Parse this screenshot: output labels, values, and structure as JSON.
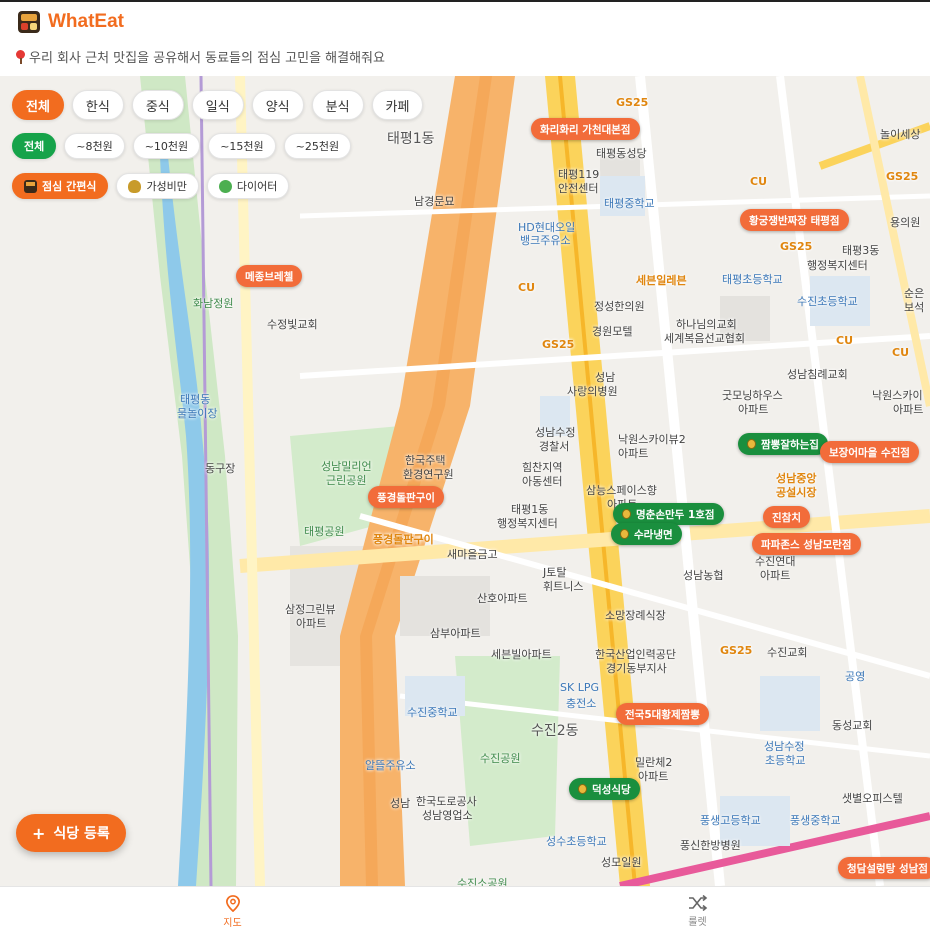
{
  "app": {
    "name": "WhatEat",
    "tagline": "우리 회사 근처 맛집을 공유해서 동료들의 점심 고민을 해결해줘요"
  },
  "filters": {
    "cuisine": [
      "전체",
      "한식",
      "중식",
      "일식",
      "양식",
      "분식",
      "카페"
    ],
    "price": [
      "전체",
      "~8천원",
      "~10천원",
      "~15천원",
      "~25천원"
    ],
    "tags": [
      "점심 간편식",
      "가성비만",
      "다이어터"
    ]
  },
  "map_labels": [
    {
      "id": "taepyeong1",
      "text": "태평1동",
      "cls": "big"
    },
    {
      "id": "taepyeong-sd",
      "text": "태평동성당",
      "cls": ""
    },
    {
      "id": "taepyeong119",
      "text": "태평119",
      "cls": ""
    },
    {
      "id": "safety",
      "text": "안전센터",
      "cls": ""
    },
    {
      "id": "taepyeong-ms",
      "text": "태평중학교",
      "cls": "blue"
    },
    {
      "id": "hd1",
      "text": "HD현대오일",
      "cls": "blue"
    },
    {
      "id": "hd2",
      "text": "뱅크주유소",
      "cls": "blue"
    },
    {
      "id": "namgyeong",
      "text": "남경문묘",
      "cls": ""
    },
    {
      "id": "sejong",
      "text": "세븐일레븐",
      "cls": "brand"
    },
    {
      "id": "cu1",
      "text": "CU",
      "cls": "brand"
    },
    {
      "id": "cu2",
      "text": "CU",
      "cls": "brand"
    },
    {
      "id": "cu3",
      "text": "CU",
      "cls": "brand"
    },
    {
      "id": "cu4",
      "text": "CU",
      "cls": "brand"
    },
    {
      "id": "gs1",
      "text": "GS25",
      "cls": "brand"
    },
    {
      "id": "gs2",
      "text": "GS25",
      "cls": "brand"
    },
    {
      "id": "gs3",
      "text": "GS25",
      "cls": "brand"
    },
    {
      "id": "gs4",
      "text": "GS25",
      "cls": "brand"
    },
    {
      "id": "gs5",
      "text": "GS25",
      "cls": "brand"
    },
    {
      "id": "jeongseong",
      "text": "정성한의원",
      "cls": ""
    },
    {
      "id": "gyeongwon",
      "text": "경원모텔",
      "cls": ""
    },
    {
      "id": "hananim1",
      "text": "하나님의교회",
      "cls": ""
    },
    {
      "id": "hananim2",
      "text": "세계복음선교협회",
      "cls": ""
    },
    {
      "id": "taepyeong-es",
      "text": "태평초등학교",
      "cls": "blue"
    },
    {
      "id": "sujin-es",
      "text": "수진초등학교",
      "cls": "blue"
    },
    {
      "id": "taepyeong3",
      "text": "태평3동",
      "cls": ""
    },
    {
      "id": "welfare3",
      "text": "행정복지센터",
      "cls": ""
    },
    {
      "id": "yongui",
      "text": "용의원",
      "cls": ""
    },
    {
      "id": "noise",
      "text": "놀이세상",
      "cls": ""
    },
    {
      "id": "sunlight",
      "text": "순은",
      "cls": ""
    },
    {
      "id": "boss",
      "text": "보석",
      "cls": ""
    },
    {
      "id": "hwanam",
      "text": "화남정원",
      "cls": "green"
    },
    {
      "id": "sujeongbit",
      "text": "수정빛교회",
      "cls": ""
    },
    {
      "id": "seongnam-hosp1",
      "text": "성남",
      "cls": ""
    },
    {
      "id": "seongnam-hosp2",
      "text": "사랑의병원",
      "cls": ""
    },
    {
      "id": "seongnamchim",
      "text": "성남침례교회",
      "cls": ""
    },
    {
      "id": "goodmorning1",
      "text": "굿모닝하우스",
      "cls": ""
    },
    {
      "id": "goodmorning2",
      "text": "아파트",
      "cls": ""
    },
    {
      "id": "naksky1",
      "text": "낙원스카이",
      "cls": ""
    },
    {
      "id": "naksky2",
      "text": "아파트",
      "cls": ""
    },
    {
      "id": "police1",
      "text": "성남수정",
      "cls": ""
    },
    {
      "id": "police2",
      "text": "경찰서",
      "cls": ""
    },
    {
      "id": "naksky3",
      "text": "낙원스카이뷰2",
      "cls": ""
    },
    {
      "id": "naksky4",
      "text": "아파트",
      "cls": ""
    },
    {
      "id": "seongnamjungang1",
      "text": "성남중앙",
      "cls": "brand"
    },
    {
      "id": "seongnamjungang2",
      "text": "공설시장",
      "cls": "brand"
    },
    {
      "id": "taepyeong-stream1",
      "text": "태평동",
      "cls": "blue"
    },
    {
      "id": "taepyeong-stream2",
      "text": "물놀이장",
      "cls": "blue"
    },
    {
      "id": "millipark1",
      "text": "성남밀리언",
      "cls": "green"
    },
    {
      "id": "millipark2",
      "text": "근린공원",
      "cls": "green"
    },
    {
      "id": "housing1",
      "text": "한국주택",
      "cls": ""
    },
    {
      "id": "housing2",
      "text": "환경연구원",
      "cls": ""
    },
    {
      "id": "childcare1",
      "text": "힘찬지역",
      "cls": ""
    },
    {
      "id": "childcare2",
      "text": "아동센터",
      "cls": ""
    },
    {
      "id": "dongu",
      "text": "동구장",
      "cls": ""
    },
    {
      "id": "samneung1",
      "text": "삼능스페이스향",
      "cls": ""
    },
    {
      "id": "samneung2",
      "text": "아파트",
      "cls": ""
    },
    {
      "id": "welfare1a",
      "text": "태평1동",
      "cls": ""
    },
    {
      "id": "welfare1b",
      "text": "행정복지센터",
      "cls": ""
    },
    {
      "id": "taepyeongpark",
      "text": "태평공원",
      "cls": "green"
    },
    {
      "id": "pungkyeong",
      "text": "풍경돌판구이",
      "cls": "brand"
    },
    {
      "id": "saemaeul",
      "text": "새마을금고",
      "cls": ""
    },
    {
      "id": "jtotal1",
      "text": "J토탈",
      "cls": ""
    },
    {
      "id": "jtotal2",
      "text": "휘트니스",
      "cls": ""
    },
    {
      "id": "sudeop",
      "text": "수진연대",
      "cls": ""
    },
    {
      "id": "sudeop2",
      "text": "아파트",
      "cls": ""
    },
    {
      "id": "nonghyup",
      "text": "성남농협",
      "cls": ""
    },
    {
      "id": "samjeong1",
      "text": "삼정그린뷰",
      "cls": ""
    },
    {
      "id": "samjeong2",
      "text": "아파트",
      "cls": ""
    },
    {
      "id": "sanho",
      "text": "산호아파트",
      "cls": ""
    },
    {
      "id": "sambu",
      "text": "삼부아파트",
      "cls": ""
    },
    {
      "id": "sobang",
      "text": "소망장례식장",
      "cls": ""
    },
    {
      "id": "serbil",
      "text": "세븐빌아파트",
      "cls": ""
    },
    {
      "id": "hrd1",
      "text": "한국산업인력공단",
      "cls": ""
    },
    {
      "id": "hrd2",
      "text": "경기동부지사",
      "cls": ""
    },
    {
      "id": "sujinchurch",
      "text": "수진교회",
      "cls": ""
    },
    {
      "id": "gongyeong",
      "text": "공영",
      "cls": "blue"
    },
    {
      "id": "sklpg1",
      "text": "SK LPG",
      "cls": "blue"
    },
    {
      "id": "sklpg2",
      "text": "충전소",
      "cls": "blue"
    },
    {
      "id": "sujin-ms",
      "text": "수진중학교",
      "cls": "blue"
    },
    {
      "id": "sujin2",
      "text": "수진2동",
      "cls": "big"
    },
    {
      "id": "sujinpark",
      "text": "수진공원",
      "cls": "green"
    },
    {
      "id": "mildae1",
      "text": "밀란체2",
      "cls": ""
    },
    {
      "id": "mildae2",
      "text": "아파트",
      "cls": ""
    },
    {
      "id": "dongseong",
      "text": "동성교회",
      "cls": ""
    },
    {
      "id": "seongnamsujeong-es1",
      "text": "성남수정",
      "cls": "blue"
    },
    {
      "id": "seongnamsujeong-es2",
      "text": "초등학교",
      "cls": "blue"
    },
    {
      "id": "allgeul",
      "text": "알뜰주유소",
      "cls": "blue"
    },
    {
      "id": "road1",
      "text": "한국도로공사",
      "cls": ""
    },
    {
      "id": "road2",
      "text": "성남영업소",
      "cls": ""
    },
    {
      "id": "seongnam-ic",
      "text": "성남",
      "cls": ""
    },
    {
      "id": "sebyeol",
      "text": "샛별오피스텔",
      "cls": ""
    },
    {
      "id": "pungsaeng-hs",
      "text": "풍생고등학교",
      "cls": "blue"
    },
    {
      "id": "pungsaeng-ms",
      "text": "풍생중학교",
      "cls": "blue"
    },
    {
      "id": "seongsu-es",
      "text": "성수초등학교",
      "cls": "blue"
    },
    {
      "id": "sinheung",
      "text": "풍신한방병원",
      "cls": ""
    },
    {
      "id": "seongmo",
      "text": "성모일원",
      "cls": ""
    },
    {
      "id": "sujinso",
      "text": "수진소공원",
      "cls": "green"
    }
  ],
  "markers": [
    {
      "id": "marker-hwari",
      "name": "화리화리 가천대본점",
      "type": "orange"
    },
    {
      "id": "marker-hwanggung",
      "name": "황궁쟁반짜장 태평점",
      "type": "orange"
    },
    {
      "id": "marker-maeul",
      "name": "메종브레첼",
      "type": "orange"
    },
    {
      "id": "marker-pungkyeong",
      "name": "풍경돌판구이",
      "type": "orange"
    },
    {
      "id": "marker-jjambbong",
      "name": "짬뽕잘하는집",
      "type": "green"
    },
    {
      "id": "marker-jangeo",
      "name": "보장어마을 수진점",
      "type": "orange"
    },
    {
      "id": "marker-myeongchun",
      "name": "명춘손만두 1호점",
      "type": "green"
    },
    {
      "id": "marker-sura",
      "name": "수라냉면",
      "type": "green"
    },
    {
      "id": "marker-jinchamchi",
      "name": "진참치",
      "type": "orange"
    },
    {
      "id": "marker-papa",
      "name": "파파존스 성남모란점",
      "type": "orange"
    },
    {
      "id": "marker-hanguk5",
      "name": "전국5대황제짬뽕",
      "type": "orange"
    },
    {
      "id": "marker-deokseong",
      "name": "덕성식당",
      "type": "green"
    },
    {
      "id": "marker-cheongdam",
      "name": "청담설렁탕 성남점",
      "type": "orange"
    }
  ],
  "register_button": "식당 등록",
  "nav": [
    {
      "id": "map",
      "label": "지도"
    },
    {
      "id": "roulette",
      "label": "룰렛"
    }
  ],
  "colors": {
    "accent": "#f26c1f",
    "green": "#16a34a",
    "marker_orange": "#f26c3a",
    "marker_green": "#1a8f3e"
  }
}
